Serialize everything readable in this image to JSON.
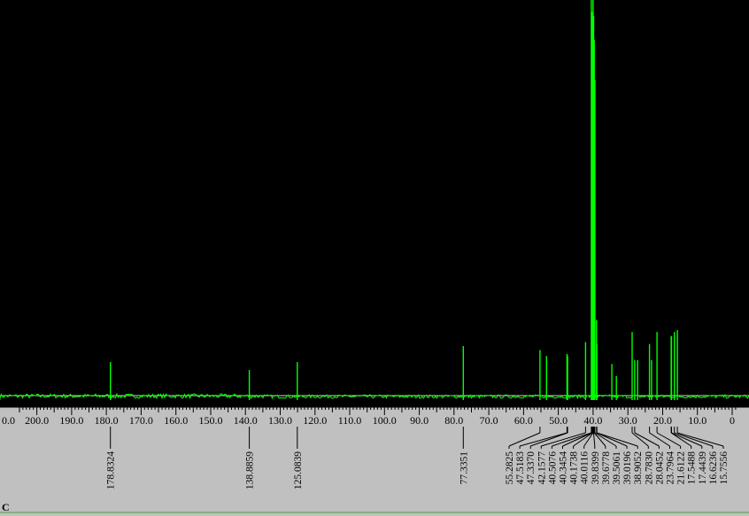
{
  "nucleus_label": "C",
  "chart_data": {
    "type": "line",
    "title": "",
    "xlabel": "",
    "ylabel": "",
    "x_axis_reversed": true,
    "xlim": [
      205.5,
      -1.5
    ],
    "colors": {
      "plot_background": "#000000",
      "axis_background": "#c0c0c0",
      "spectrum": "#00ff00",
      "baseline_guide": "#d9d9c8"
    },
    "tick_labels": [
      "0.0",
      "200.0",
      "190.0",
      "180.0",
      "170.0",
      "160.0",
      "150.0",
      "140.0",
      "130.0",
      "120.0",
      "110.0",
      "100.0",
      "90.0",
      "80.0",
      "70.0",
      "60.0",
      "50.0",
      "40.0",
      "30.0",
      "20.0",
      "10.0",
      "0"
    ],
    "tick_values": [
      210,
      200,
      190,
      180,
      170,
      160,
      150,
      140,
      130,
      120,
      110,
      100,
      90,
      80,
      70,
      60,
      50,
      40,
      30,
      20,
      10,
      0
    ],
    "peaks": [
      {
        "ppm": 178.8324,
        "label": "178.8324",
        "height": 0.095
      },
      {
        "ppm": 138.8859,
        "label": "138.8859",
        "height": 0.075
      },
      {
        "ppm": 125.0839,
        "label": "125.0839",
        "height": 0.095
      },
      {
        "ppm": 77.3351,
        "label": "77.3351",
        "height": 0.135
      },
      {
        "ppm": 55.2825,
        "label": "55.2825",
        "height": 0.125
      },
      {
        "ppm": 53.4,
        "label": "",
        "height": 0.11
      },
      {
        "ppm": 47.5183,
        "label": "47.5183",
        "height": 0.115
      },
      {
        "ppm": 47.337,
        "label": "47.3370",
        "height": 0.11
      },
      {
        "ppm": 42.1577,
        "label": "42.1577",
        "height": 0.145
      },
      {
        "ppm": 40.5076,
        "label": "40.5076",
        "height": 1.0
      },
      {
        "ppm": 40.3454,
        "label": "40.3454",
        "height": 0.95
      },
      {
        "ppm": 40.1738,
        "label": "40.1738",
        "height": 0.97
      },
      {
        "ppm": 40.0116,
        "label": "40.0116",
        "height": 1.0
      },
      {
        "ppm": 39.8399,
        "label": "39.8399",
        "height": 0.96
      },
      {
        "ppm": 39.6778,
        "label": "39.6778",
        "height": 0.9
      },
      {
        "ppm": 39.5061,
        "label": "39.5061",
        "height": 0.8
      },
      {
        "ppm": 39.0196,
        "label": "39.0196",
        "height": 0.2
      },
      {
        "ppm": 38.9052,
        "label": "38.9052",
        "height": 0.14
      },
      {
        "ppm": 34.6,
        "label": "",
        "height": 0.09
      },
      {
        "ppm": 33.3,
        "label": "",
        "height": 0.06
      },
      {
        "ppm": 28.783,
        "label": "28.7830",
        "height": 0.17
      },
      {
        "ppm": 28.0452,
        "label": "28.0452",
        "height": 0.1
      },
      {
        "ppm": 27.2,
        "label": "",
        "height": 0.1
      },
      {
        "ppm": 23.7964,
        "label": "23.7964",
        "height": 0.14
      },
      {
        "ppm": 23.2,
        "label": "",
        "height": 0.1
      },
      {
        "ppm": 21.6122,
        "label": "21.6122",
        "height": 0.17
      },
      {
        "ppm": 17.5488,
        "label": "17.5488",
        "height": 0.16
      },
      {
        "ppm": 17.4439,
        "label": "17.4439",
        "height": 0.16
      },
      {
        "ppm": 16.6236,
        "label": "16.6236",
        "height": 0.17
      },
      {
        "ppm": 15.7556,
        "label": "15.7556",
        "height": 0.175
      }
    ]
  }
}
